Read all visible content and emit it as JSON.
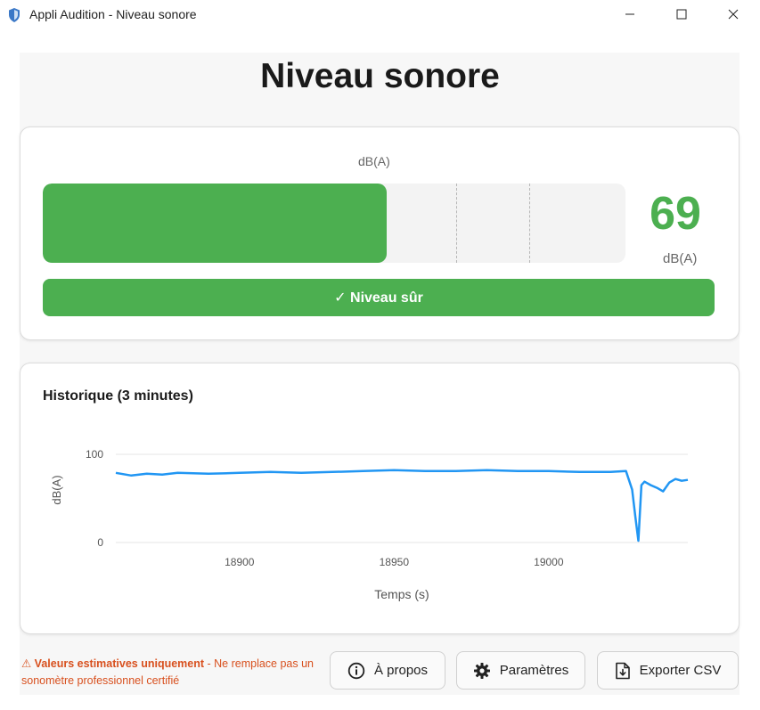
{
  "window": {
    "title": "Appli Audition - Niveau sonore",
    "controls": [
      "minimize",
      "maximize",
      "close"
    ]
  },
  "page": {
    "title": "Niveau sonore"
  },
  "meter": {
    "unit_top": "dB(A)",
    "value": "69",
    "unit": "dB(A)",
    "level_fraction": 0.59,
    "threshold_fractions": [
      0.71,
      0.835
    ],
    "status": "✓ Niveau sûr",
    "color": "#4caf50"
  },
  "history": {
    "title": "Historique (3 minutes)",
    "chart_data": {
      "type": "line",
      "xlabel": "Temps (s)",
      "ylabel": "dB(A)",
      "xlim": [
        18860,
        19045
      ],
      "ylim": [
        0,
        100
      ],
      "xticks": [
        "18900",
        "18950",
        "19000"
      ],
      "yticks": [
        "0",
        "100"
      ],
      "grid": true,
      "series": [
        {
          "color": "#2196f3",
          "x": [
            18860,
            18865,
            18870,
            18875,
            18880,
            18890,
            18900,
            18910,
            18920,
            18930,
            18940,
            18950,
            18960,
            18970,
            18980,
            18990,
            19000,
            19010,
            19020,
            19025,
            19027,
            19028,
            19029,
            19030,
            19031,
            19033,
            19035,
            19037,
            19039,
            19041,
            19043,
            19045
          ],
          "y": [
            79,
            76,
            78,
            77,
            79,
            78,
            79,
            80,
            79,
            80,
            81,
            82,
            81,
            81,
            82,
            81,
            81,
            80,
            80,
            81,
            60,
            30,
            2,
            65,
            69,
            65,
            62,
            58,
            68,
            72,
            70,
            71
          ]
        }
      ]
    }
  },
  "footer": {
    "disclaimer_bold": "⚠ Valeurs estimatives uniquement",
    "disclaimer_rest": " - Ne remplace pas un sonomètre professionnel certifié",
    "buttons": {
      "about": "À propos",
      "settings": "Paramètres",
      "export": "Exporter CSV"
    }
  },
  "icons": {
    "app": "shield-icon",
    "about": "info-icon",
    "settings": "gear-icon",
    "export": "file-download-icon"
  }
}
